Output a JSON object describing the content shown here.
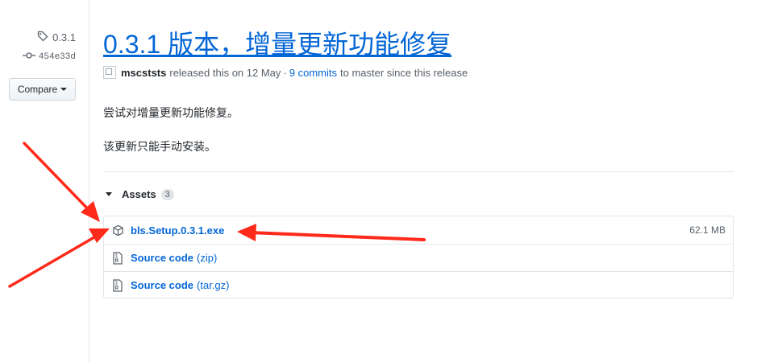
{
  "sidebar": {
    "tag": "0.3.1",
    "commit": "454e33d",
    "compare_label": "Compare"
  },
  "release": {
    "title": "0.3.1 版本，增量更新功能修复",
    "author": "mscststs",
    "released_text": "released this on 12 May",
    "separator": "·",
    "commits_link": "9 commits",
    "commits_suffix": "to master since this release",
    "description": [
      "尝试对增量更新功能修复。",
      "该更新只能手动安装。"
    ]
  },
  "assets": {
    "heading": "Assets",
    "count": "3",
    "items": [
      {
        "name": "bls.Setup.0.3.1.exe",
        "suffix": "",
        "size": "62.1 MB",
        "icon": "package-icon"
      },
      {
        "name": "Source code",
        "suffix": "(zip)",
        "size": "",
        "icon": "file-zip-icon"
      },
      {
        "name": "Source code",
        "suffix": "(tar.gz)",
        "size": "",
        "icon": "file-zip-icon"
      }
    ]
  },
  "annotation": {
    "arrow_color": "#ff2a1a"
  }
}
